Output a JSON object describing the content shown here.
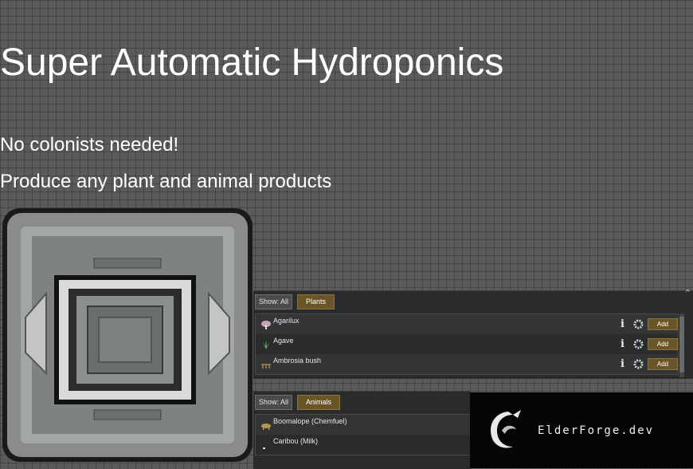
{
  "title": "Super Automatic Hydroponics",
  "subtitle1": "No colonists needed!",
  "subtitle2": "Produce any plant and animal products",
  "plants_panel": {
    "show_label": "Show: All",
    "category_label": "Plants",
    "collapse_icon": "chevron-up-icon",
    "items": [
      {
        "name": "Agarilux",
        "icon": "mushroom-icon",
        "add_label": "Add"
      },
      {
        "name": "Agave",
        "icon": "agave-icon",
        "add_label": "Add"
      },
      {
        "name": "Ambrosia bush",
        "icon": "bush-icon",
        "add_label": "Add"
      }
    ]
  },
  "animals_panel": {
    "show_label": "Show: All",
    "category_label": "Animals",
    "items": [
      {
        "name": "Boomalope  (Chemfuel)",
        "icon": "boomalope-icon"
      },
      {
        "name": "Caribou  (Milk)",
        "icon": "caribou-icon"
      }
    ]
  },
  "logo": {
    "text": "ElderForge.dev",
    "icon": "dragon-logo-icon"
  },
  "colors": {
    "accent_button": "#6a5526",
    "panel_bg": "#2a2b2c",
    "background": "#5b5b5b"
  }
}
